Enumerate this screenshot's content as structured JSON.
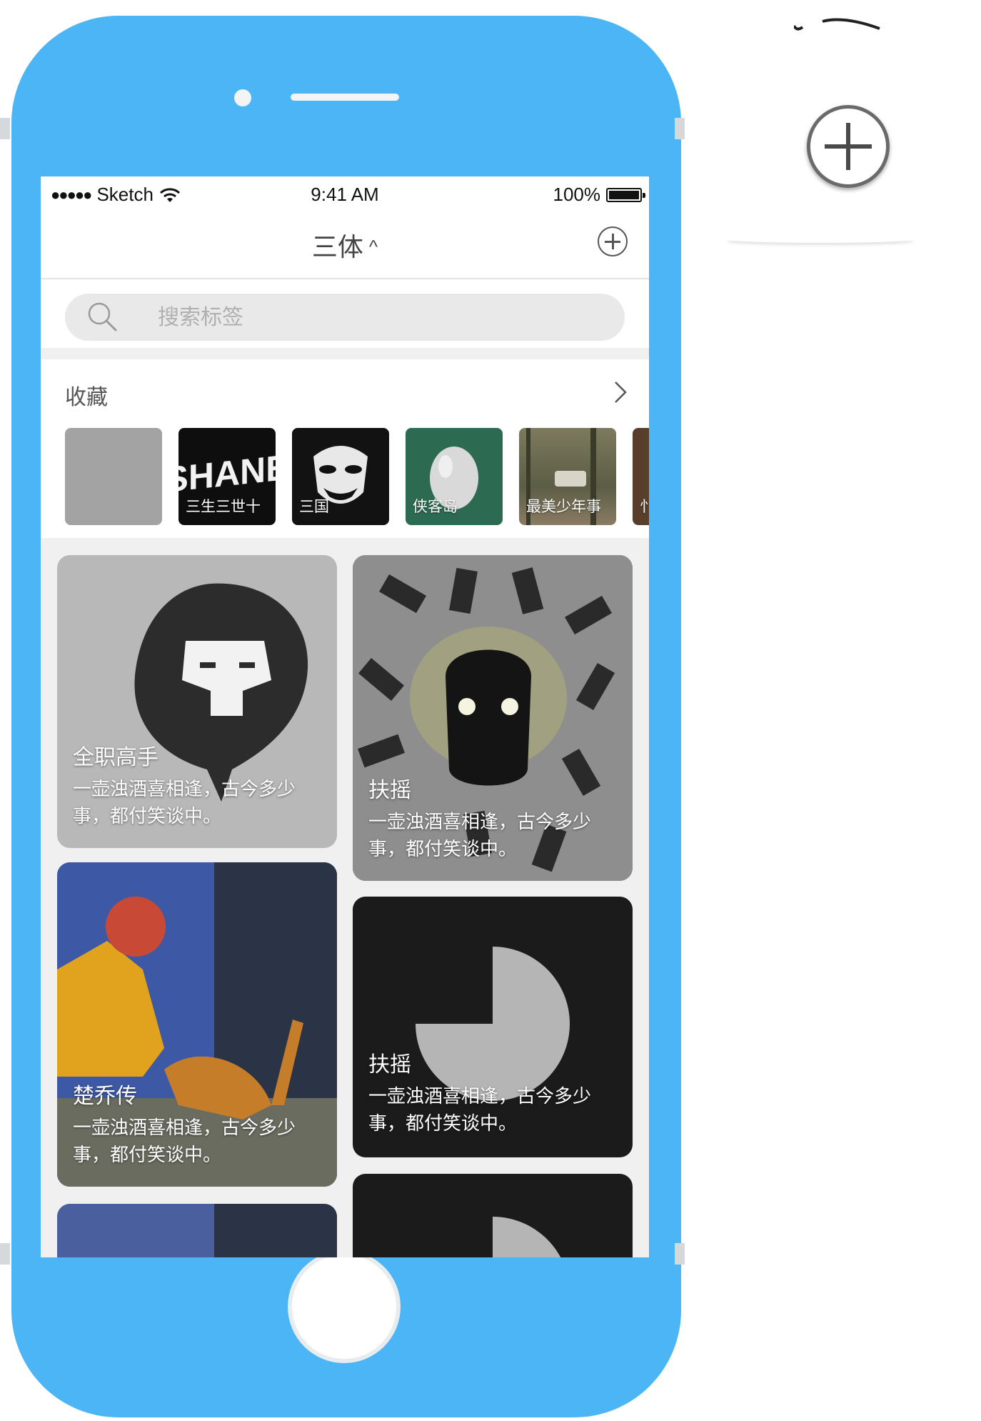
{
  "status_bar": {
    "signal": "●●●●●",
    "carrier": "Sketch",
    "time": "9:41 AM",
    "battery": "100%",
    "battery_level": 1.0
  },
  "nav": {
    "title": "三体",
    "title_chevron": "^",
    "add_icon": "plus-circle-icon"
  },
  "search": {
    "placeholder": "搜索标签",
    "icon": "search-icon"
  },
  "favorites": {
    "title": "收藏",
    "more_icon": "chevron-right-icon",
    "items": [
      {
        "label": "",
        "color": "#a3a3a3"
      },
      {
        "label": "三生三世十",
        "color": "#0e0e0e"
      },
      {
        "label": "三国",
        "color": "#121212"
      },
      {
        "label": "侠客岛",
        "color": "#2c6a52"
      },
      {
        "label": "最美少年事",
        "color": "#6b6650"
      },
      {
        "label": "忄",
        "color": "#4b5b3a"
      }
    ]
  },
  "feed": {
    "cards": [
      {
        "title": "全职高手",
        "desc": "一壶浊酒喜相逢，古今多少事，都付笑谈中。",
        "color": "#b6b6b6"
      },
      {
        "title": "扶摇",
        "desc": "一壶浊酒喜相逢，古今多少事，都付笑谈中。",
        "color": "#8a8a8a"
      },
      {
        "title": "楚乔传",
        "desc": "一壶浊酒喜相逢，古今多少事，都付笑谈中。",
        "color": "#3c5aa8"
      },
      {
        "title": "扶摇",
        "desc": "一壶浊酒喜相逢，古今多少事，都付笑谈中。",
        "color": "#1b1b1b"
      },
      {
        "title": "",
        "desc": "",
        "color": "#5a6a9a"
      },
      {
        "title": "",
        "desc": "",
        "color": "#1b1b1b"
      }
    ]
  },
  "side_panel": {
    "add_icon": "plus-circle-icon"
  },
  "colors": {
    "phone_body": "#4cb5f5",
    "screen_bg": "#f0f0f0"
  }
}
